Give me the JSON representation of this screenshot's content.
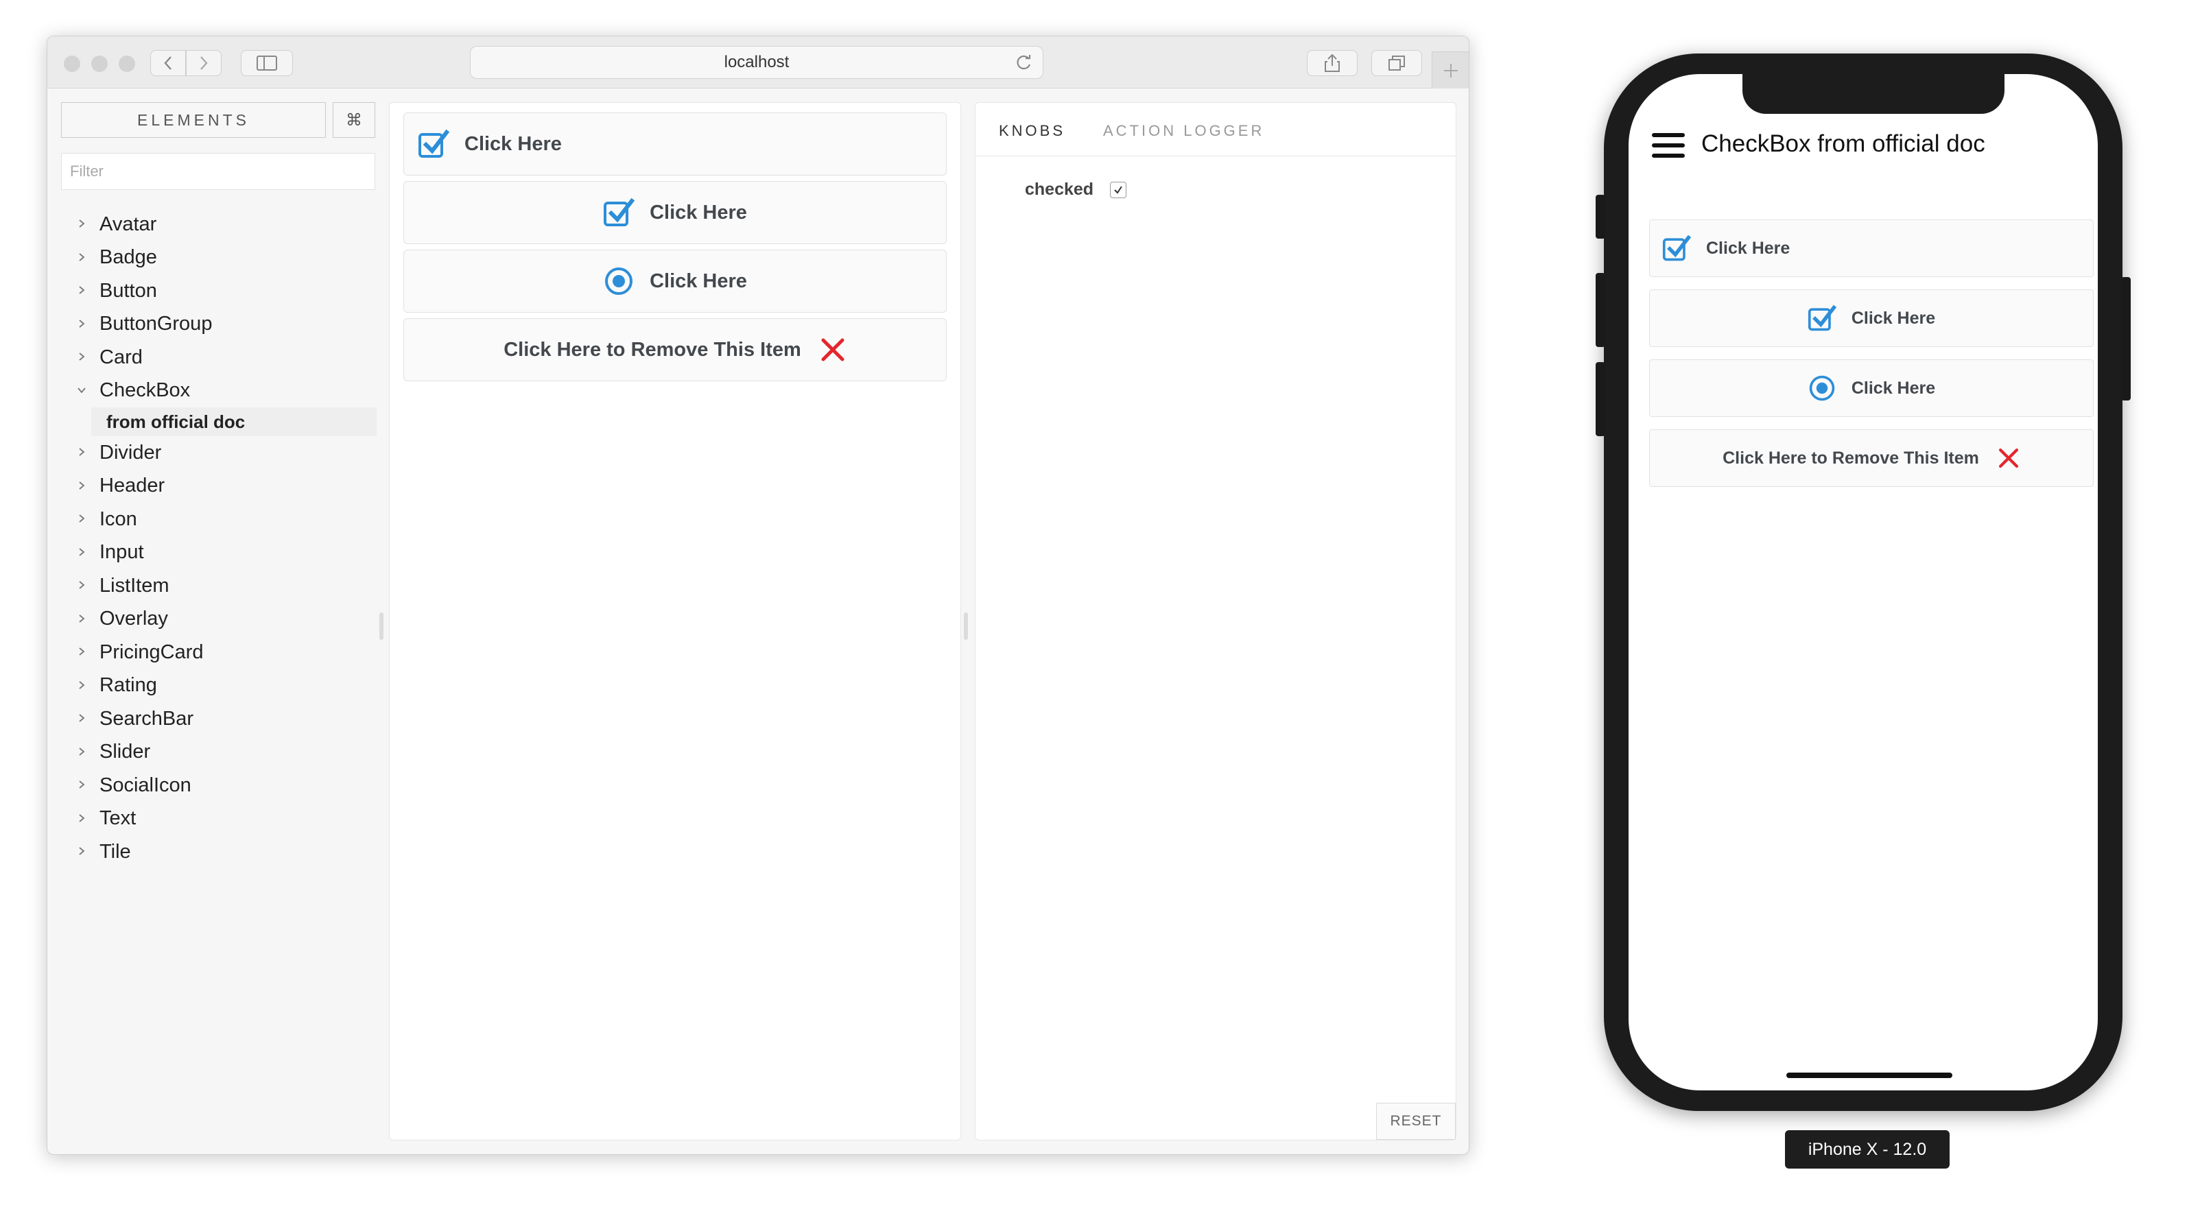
{
  "browser": {
    "url": "localhost"
  },
  "sidebar": {
    "elements_label": "ELEMENTS",
    "shortcut_label": "⌘",
    "filter_placeholder": "Filter",
    "items": [
      {
        "label": "Avatar"
      },
      {
        "label": "Badge"
      },
      {
        "label": "Button"
      },
      {
        "label": "ButtonGroup"
      },
      {
        "label": "Card"
      },
      {
        "label": "CheckBox",
        "expanded": true
      },
      {
        "label": "Divider"
      },
      {
        "label": "Header"
      },
      {
        "label": "Icon"
      },
      {
        "label": "Input"
      },
      {
        "label": "ListItem"
      },
      {
        "label": "Overlay"
      },
      {
        "label": "PricingCard"
      },
      {
        "label": "Rating"
      },
      {
        "label": "SearchBar"
      },
      {
        "label": "Slider"
      },
      {
        "label": "SocialIcon"
      },
      {
        "label": "Text"
      },
      {
        "label": "Tile"
      }
    ],
    "selected_story": "from official doc"
  },
  "preview": {
    "checkboxes": [
      {
        "label": "Click Here",
        "icon": "checked-square-icon",
        "align": "left"
      },
      {
        "label": "Click Here",
        "icon": "checked-square-icon",
        "align": "center"
      },
      {
        "label": "Click Here",
        "icon": "radio-dot-icon",
        "align": "center"
      },
      {
        "label": "Click Here to Remove This Item",
        "icon": "close-x-icon",
        "align": "center",
        "icon_right": true
      }
    ]
  },
  "addons": {
    "tabs": [
      "KNOBS",
      "ACTION LOGGER"
    ],
    "active_tab": "KNOBS",
    "knob_label": "checked",
    "knob_value": true,
    "reset_label": "RESET"
  },
  "phone": {
    "title": "CheckBox from official doc",
    "checkboxes": [
      {
        "label": "Click Here"
      },
      {
        "label": "Click Here"
      },
      {
        "label": "Click Here"
      },
      {
        "label": "Click Here to Remove This Item"
      }
    ],
    "device_label": "iPhone X - 12.0"
  },
  "colors": {
    "accent_blue": "#2d8ed8",
    "remove_red": "#e3262c"
  }
}
